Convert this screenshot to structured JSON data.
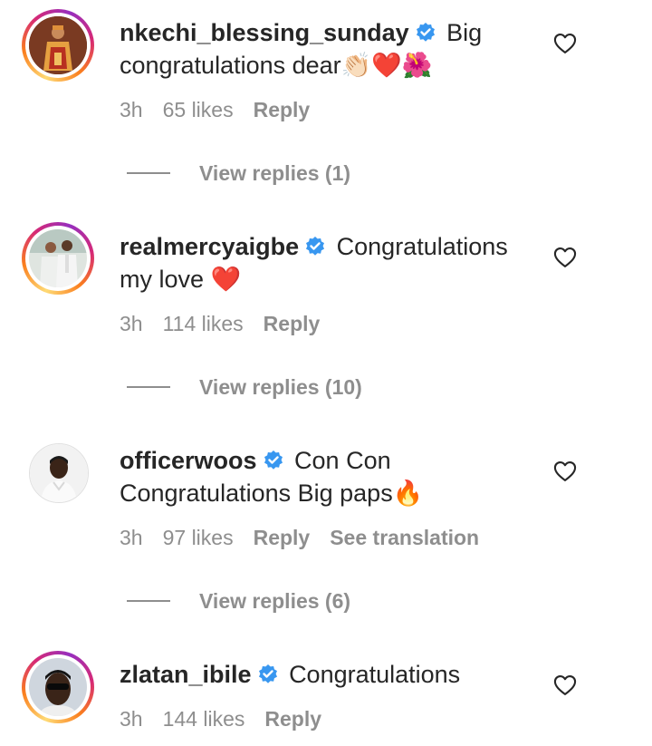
{
  "comments": [
    {
      "username": "nkechi_blessing_sunday",
      "text": "Big congratulations dear",
      "emojis": "👏🏻❤️🌺",
      "time": "3h",
      "likes": "65 likes",
      "reply": "Reply",
      "view_replies": "View replies (1)",
      "has_story_ring": true
    },
    {
      "username": "realmercyaigbe",
      "text": "Congratulations my love",
      "emojis": "❤️",
      "time": "3h",
      "likes": "114 likes",
      "reply": "Reply",
      "view_replies": "View replies (10)",
      "has_story_ring": true
    },
    {
      "username": "officerwoos",
      "text": "Con Con Congratulations Big paps",
      "emojis": "🔥",
      "time": "3h",
      "likes": "97 likes",
      "reply": "Reply",
      "see_translation": "See translation",
      "view_replies": "View replies (6)",
      "has_story_ring": false
    },
    {
      "username": "zlatan_ibile",
      "text": "Congratulations",
      "emojis": "",
      "time": "3h",
      "likes": "144 likes",
      "reply": "Reply",
      "has_story_ring": true
    }
  ],
  "icons": {
    "verified": "verified-badge-icon",
    "like": "heart-outline-icon"
  },
  "colors": {
    "verified_blue": "#3897f0",
    "text_primary": "#262626",
    "text_secondary": "#8e8e8e"
  }
}
